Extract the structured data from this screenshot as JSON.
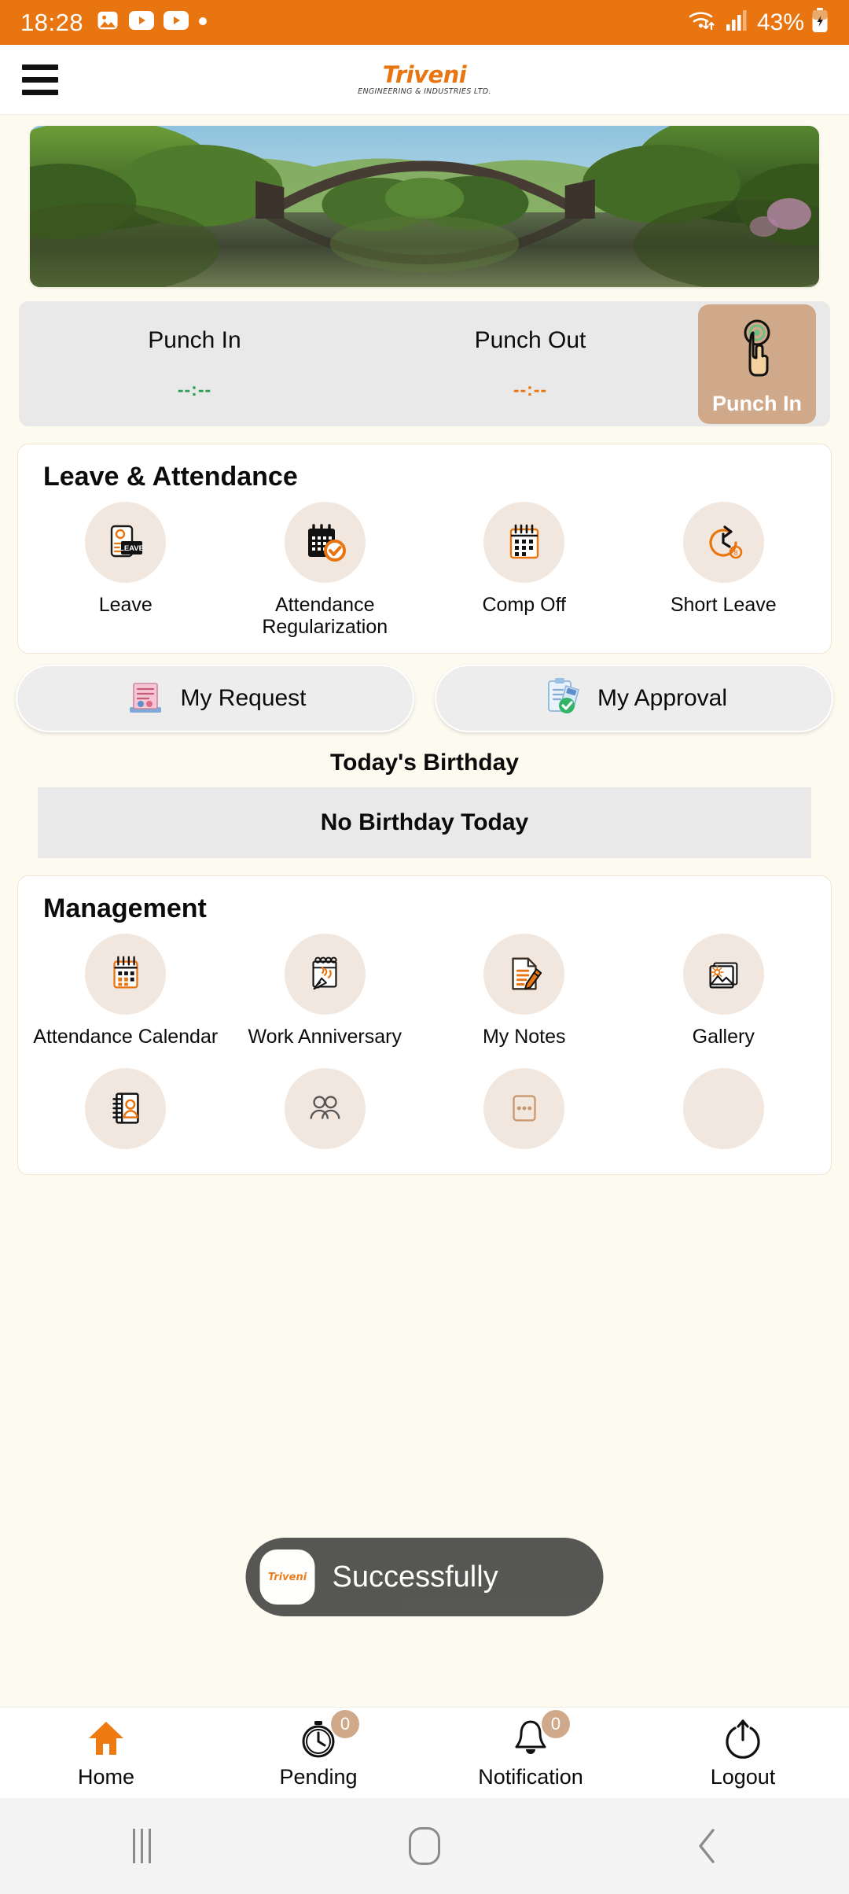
{
  "status_bar": {
    "time": "18:28",
    "notification_icons": [
      "image-icon",
      "youtube-icon",
      "youtube-icon",
      "dot-icon"
    ],
    "wifi_icon": "wifi-icon",
    "signal_icon": "signal-bars-icon",
    "battery_percent": "43%",
    "battery_icon": "battery-charging-icon",
    "background_color": "#E8750F"
  },
  "app_bar": {
    "menu_icon": "hamburger-menu-icon",
    "brand_name": "Triveni",
    "brand_tagline": "ENGINEERING & INDUSTRIES LTD.",
    "brand_color": "#E8750F"
  },
  "banner": {
    "alt": "Stone arch bridge over calm lake with circular reflection surrounded by green trees"
  },
  "punch": {
    "in_label": "Punch In",
    "in_time": "--:--",
    "in_color": "#2E9E52",
    "out_label": "Punch Out",
    "out_time": "--:--",
    "out_color": "#E8750F",
    "button_label": "Punch In",
    "button_icon": "finger-tap-icon",
    "button_color": "#CFA98A"
  },
  "leave_attendance": {
    "title": "Leave & Attendance",
    "tiles": [
      {
        "label": "Leave",
        "icon": "leave-card-icon"
      },
      {
        "label": "Attendance Regularization",
        "icon": "calendar-check-icon"
      },
      {
        "label": "Comp Off",
        "icon": "calendar-grid-icon"
      },
      {
        "label": "Short Leave",
        "icon": "clock-arrow-icon"
      }
    ]
  },
  "quick_links": [
    {
      "label": "My Request",
      "icon": "request-document-icon"
    },
    {
      "label": "My Approval",
      "icon": "approval-clipboard-icon"
    }
  ],
  "birthday": {
    "title": "Today's Birthday",
    "empty_text": "No Birthday Today"
  },
  "management": {
    "title": "Management",
    "tiles": [
      {
        "label": "Attendance Calendar",
        "icon": "calendar-grid-icon"
      },
      {
        "label": "Work Anniversary",
        "icon": "party-notepad-icon"
      },
      {
        "label": "My Notes",
        "icon": "note-pencil-icon"
      },
      {
        "label": "Gallery",
        "icon": "photo-gallery-icon"
      }
    ],
    "tiles_row2": [
      {
        "label": "",
        "icon": "contact-book-icon"
      },
      {
        "label": "",
        "icon": "people-icon"
      },
      {
        "label": "",
        "icon": "more-options-icon"
      },
      {
        "label": "",
        "icon": "blank-icon"
      }
    ]
  },
  "toast": {
    "message": "Successfully",
    "icon": "triveni-app-logo-icon",
    "logo_text": "Triveni"
  },
  "bottom_nav": [
    {
      "label": "Home",
      "icon": "home-icon",
      "badge": null,
      "active": true
    },
    {
      "label": "Pending",
      "icon": "clock-icon",
      "badge": "0",
      "active": false
    },
    {
      "label": "Notification",
      "icon": "bell-icon",
      "badge": "0",
      "active": false
    },
    {
      "label": "Logout",
      "icon": "power-icon",
      "badge": null,
      "active": false
    }
  ],
  "android_nav": {
    "recents_icon": "recents-icon",
    "home_icon": "home-square-icon",
    "back_icon": "back-chevron-icon"
  }
}
